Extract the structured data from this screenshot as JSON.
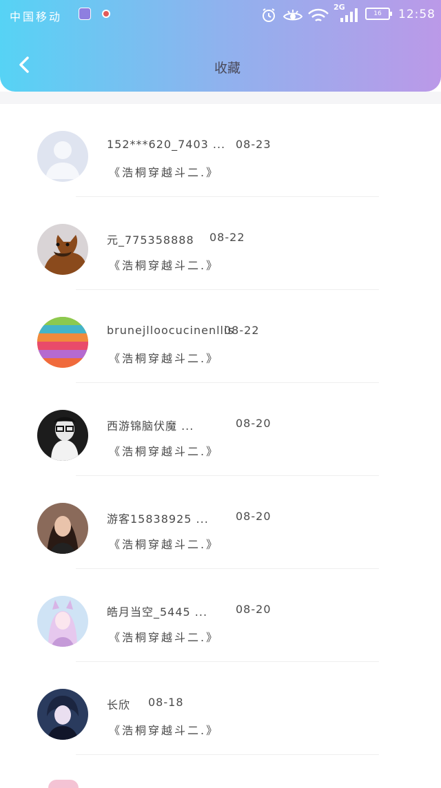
{
  "status_bar": {
    "carrier": "中国移动",
    "network_type": "2G",
    "battery": "16",
    "time": "12:58"
  },
  "header": {
    "title": "收藏"
  },
  "items": [
    {
      "name": "152***620_7403 ...",
      "date": "08-23",
      "story": "《浩桐穿越斗二.》",
      "avatar": "default-avatar"
    },
    {
      "name": "元_775358888",
      "date": "08-22",
      "story": "《浩桐穿越斗二.》",
      "avatar": "dog-avatar"
    },
    {
      "name": "brunejlloocucinenllis",
      "date": "08-22",
      "story": "《浩桐穿越斗二.》",
      "avatar": "mustache-pattern-avatar"
    },
    {
      "name": "西游锦脑伏魔 ...",
      "date": "08-20",
      "story": "《浩桐穿越斗二.》",
      "avatar": "glasses-avatar"
    },
    {
      "name": "游客15838925 ...",
      "date": "08-20",
      "story": "《浩桐穿越斗二.》",
      "avatar": "woman-avatar"
    },
    {
      "name": "皓月当空_5445 ...",
      "date": "08-20",
      "story": "《浩桐穿越斗二.》",
      "avatar": "anime-girl-avatar"
    },
    {
      "name": "长欣",
      "date": "08-18",
      "story": "《浩桐穿越斗二.》",
      "avatar": "anime-boy-avatar"
    }
  ]
}
